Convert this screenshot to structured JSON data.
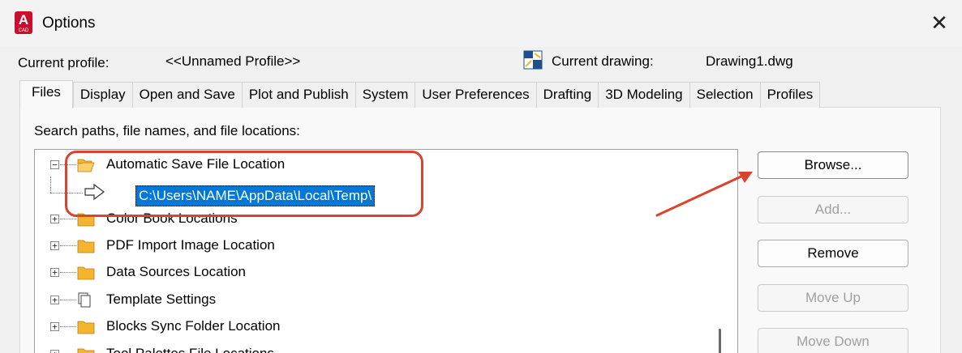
{
  "window": {
    "title": "Options",
    "app_icon_letter": "A",
    "app_icon_sub": "CAD",
    "close_glyph": "✕"
  },
  "header": {
    "profile_label": "Current profile:",
    "profile_value": "<<Unnamed Profile>>",
    "drawing_label": "Current drawing:",
    "drawing_value": "Drawing1.dwg"
  },
  "tabs": [
    {
      "label": "Files",
      "active": true
    },
    {
      "label": "Display"
    },
    {
      "label": "Open and Save"
    },
    {
      "label": "Plot and Publish"
    },
    {
      "label": "System"
    },
    {
      "label": "User Preferences"
    },
    {
      "label": "Drafting"
    },
    {
      "label": "3D Modeling"
    },
    {
      "label": "Selection"
    },
    {
      "label": "Profiles"
    }
  ],
  "files_panel": {
    "caption": "Search paths, file names, and file locations:",
    "tree": [
      {
        "label": "Automatic Save File Location",
        "expanded": true,
        "expander": "−",
        "icon": "open-folder-icon"
      },
      {
        "label": "Color Book Locations",
        "expander": "+",
        "icon": "folder-icon"
      },
      {
        "label": "PDF Import Image Location",
        "expander": "+",
        "icon": "folder-icon"
      },
      {
        "label": "Data Sources Location",
        "expander": "+",
        "icon": "folder-icon"
      },
      {
        "label": "Template Settings",
        "expander": "+",
        "icon": "stacked-pages-icon"
      },
      {
        "label": "Blocks Sync Folder Location",
        "expander": "+",
        "icon": "folder-icon"
      },
      {
        "label": "Tool Palettes File Locations",
        "expander": "+",
        "icon": "folder-icon"
      }
    ],
    "selected_path": "C:\\Users\\NAME\\AppData\\Local\\Temp\\"
  },
  "buttons": {
    "browse": "Browse...",
    "add": "Add...",
    "remove": "Remove",
    "move_up": "Move Up",
    "move_down": "Move Down"
  },
  "colors": {
    "selection": "#0078d7",
    "annotation": "#d9442f",
    "folder": "#f5b42f"
  }
}
